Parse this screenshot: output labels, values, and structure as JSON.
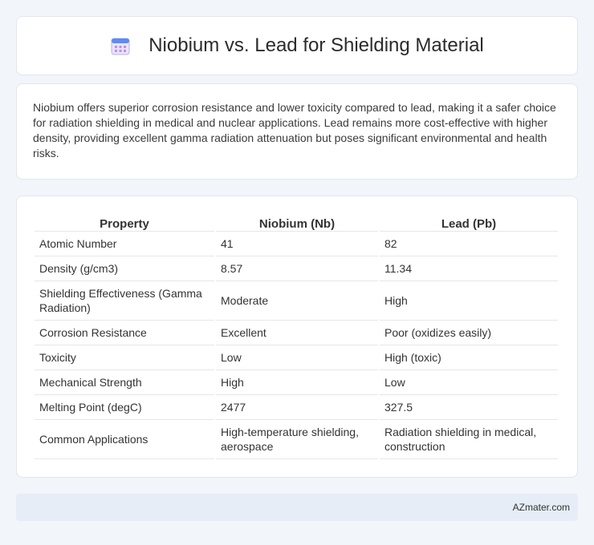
{
  "header": {
    "title": "Niobium vs. Lead for Shielding Material",
    "icon": "calendar-icon"
  },
  "summary": {
    "text": "Niobium offers superior corrosion resistance and lower toxicity compared to lead, making it a safer choice for radiation shielding in medical and nuclear applications. Lead remains more cost-effective with higher density, providing excellent gamma radiation attenuation but poses significant environmental and health risks."
  },
  "table": {
    "headers": [
      "Property",
      "Niobium (Nb)",
      "Lead (Pb)"
    ],
    "rows": [
      [
        "Atomic Number",
        "41",
        "82"
      ],
      [
        "Density (g/cm3)",
        "8.57",
        "11.34"
      ],
      [
        "Shielding Effectiveness (Gamma Radiation)",
        "Moderate",
        "High"
      ],
      [
        "Corrosion Resistance",
        "Excellent",
        "Poor (oxidizes easily)"
      ],
      [
        "Toxicity",
        "Low",
        "High (toxic)"
      ],
      [
        "Mechanical Strength",
        "High",
        "Low"
      ],
      [
        "Melting Point (degC)",
        "2477",
        "327.5"
      ],
      [
        "Common Applications",
        "High-temperature shielding, aerospace",
        "Radiation shielding in medical, construction"
      ]
    ]
  },
  "footer": {
    "brand": "AZmater.com"
  }
}
